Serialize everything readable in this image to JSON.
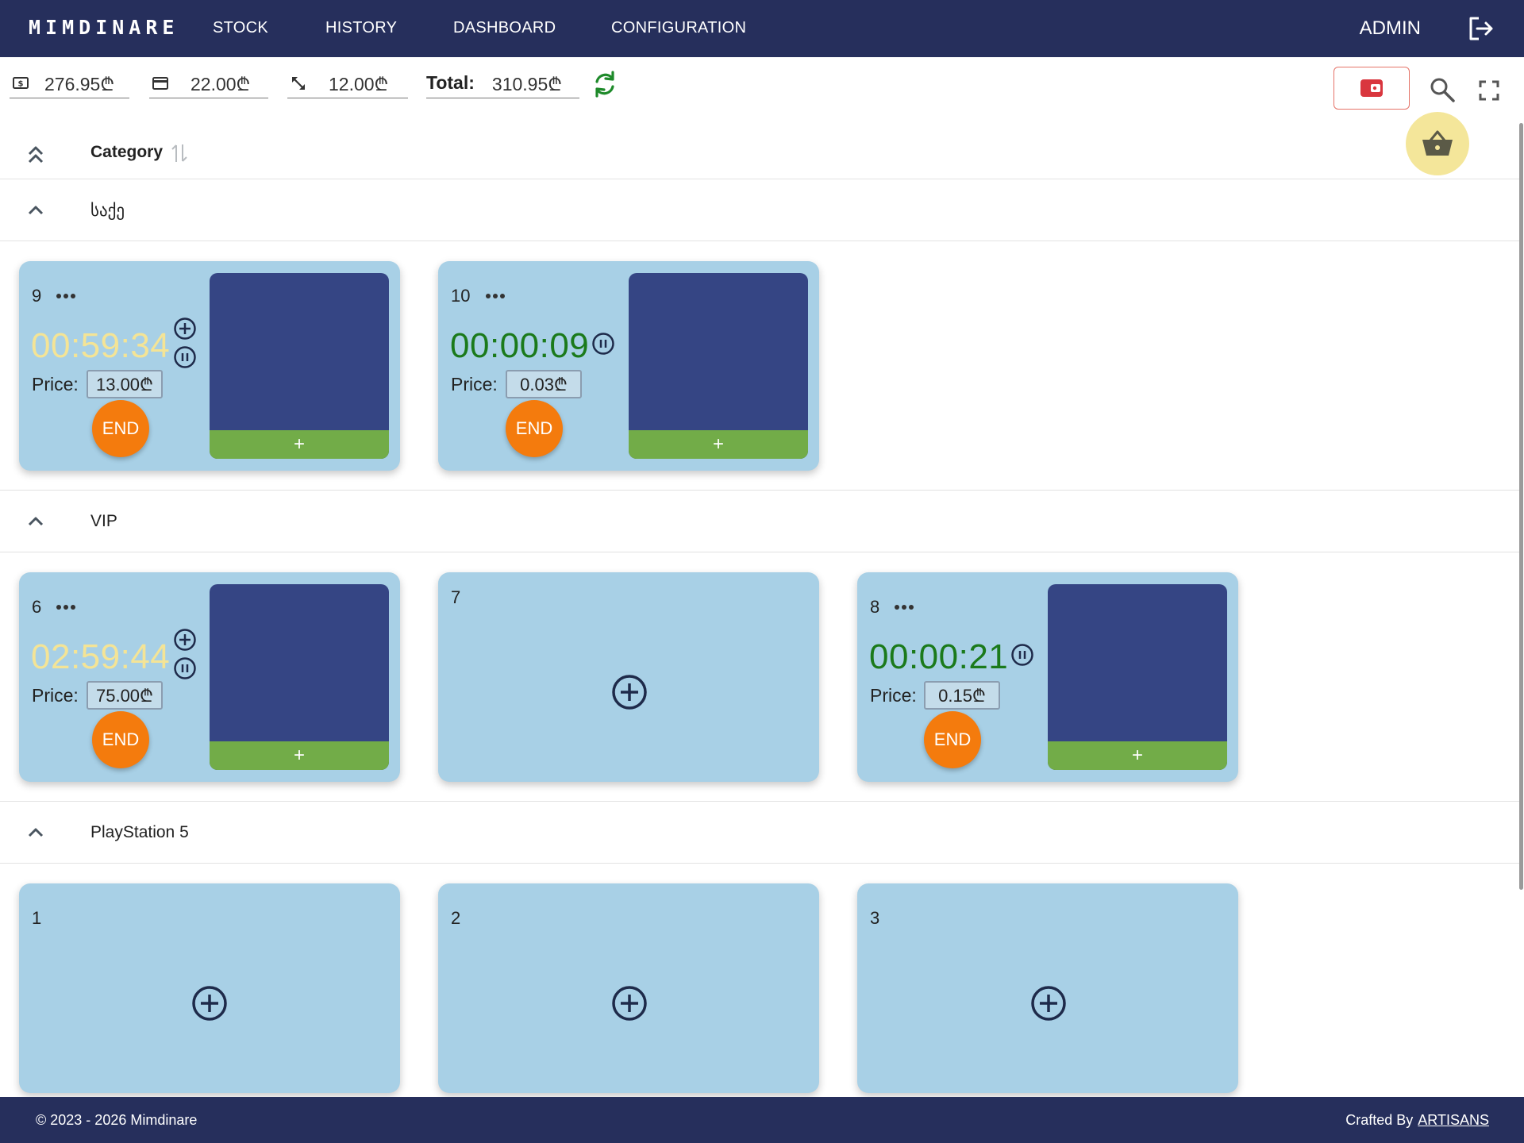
{
  "brand": "MIMDINARE",
  "nav": {
    "items": [
      {
        "label": "STOCK"
      },
      {
        "label": "HISTORY"
      },
      {
        "label": "DASHBOARD"
      },
      {
        "label": "CONFIGURATION"
      }
    ],
    "user": "ADMIN"
  },
  "summary": {
    "cash": "276.95₾",
    "card": "22.00₾",
    "transfer": "12.00₾",
    "total_label": "Total:",
    "total": "310.95₾"
  },
  "list": {
    "column_title": "Category"
  },
  "groups": [
    {
      "name": "საქე",
      "cards": [
        {
          "number": "9",
          "timer": "00:59:34",
          "price_label": "Price:",
          "price": "13.00₾",
          "end_label": "END",
          "add_label": "+"
        },
        {
          "number": "10",
          "timer": "00:00:09",
          "price_label": "Price:",
          "price": "0.03₾",
          "end_label": "END",
          "add_label": "+"
        }
      ]
    },
    {
      "name": "VIP",
      "cards": [
        {
          "number": "6",
          "timer": "02:59:44",
          "price_label": "Price:",
          "price": "75.00₾",
          "end_label": "END",
          "add_label": "+"
        },
        {
          "number": "7"
        },
        {
          "number": "8",
          "timer": "00:00:21",
          "price_label": "Price:",
          "price": "0.15₾",
          "end_label": "END",
          "add_label": "+"
        }
      ]
    },
    {
      "name": "PlayStation 5",
      "cards": [
        {
          "number": "1"
        },
        {
          "number": "2"
        },
        {
          "number": "3"
        }
      ]
    }
  ],
  "footer": {
    "copyright": "© 2023 - 2026 Mimdinare",
    "crafted_label": "Crafted By",
    "crafted_link": "ARTISANS"
  },
  "colors": {
    "nav_bg": "#262f5c",
    "card_bg": "#a8d0e6",
    "panel_bg": "#354584",
    "add_bar": "#72ac48",
    "end_button": "#f47b0d",
    "timer_running_over": "#f4e496",
    "timer_running": "#1b7a1b",
    "basket_bg": "#f4e69a",
    "wallet_red": "#d9363e"
  },
  "icons": [
    "cash-icon",
    "card-icon",
    "transfer-icon",
    "refresh-icon",
    "wallet-icon",
    "search-icon",
    "fullscreen-icon",
    "basket-icon",
    "logout-icon",
    "collapse-all-icon",
    "sort-icon",
    "chevron-up-icon",
    "more-dots-icon",
    "plus-circle-icon",
    "pause-circle-icon"
  ]
}
